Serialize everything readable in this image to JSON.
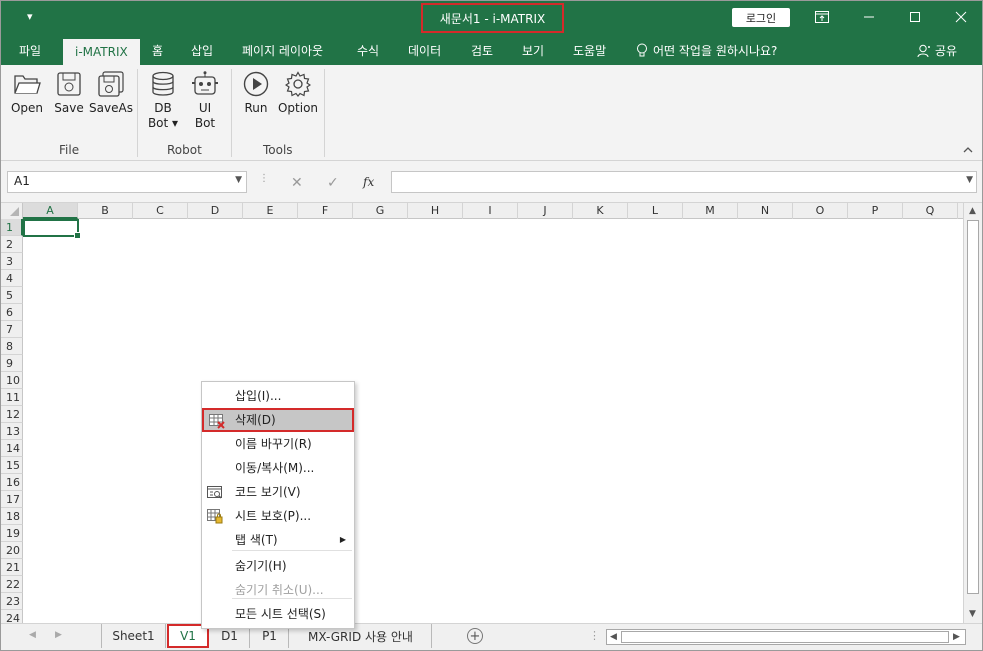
{
  "titlebar": {
    "qat_icon": "customize-arrow",
    "title": "새문서1  -  i-MATRIX",
    "login_label": "로그인",
    "controls": [
      "ribbon-display-icon",
      "minimize-icon",
      "maximize-icon",
      "close-icon"
    ]
  },
  "tabs": [
    {
      "label": "파일"
    },
    {
      "label": "i-MATRIX",
      "active": true
    },
    {
      "label": "홈"
    },
    {
      "label": "삽입"
    },
    {
      "label": "페이지 레이아웃"
    },
    {
      "label": "수식"
    },
    {
      "label": "데이터"
    },
    {
      "label": "검토"
    },
    {
      "label": "보기"
    },
    {
      "label": "도움말"
    },
    {
      "label": "어떤 작업을 원하시나요?"
    }
  ],
  "share_label": "공유",
  "ribbon": {
    "groups": [
      {
        "label": "File",
        "buttons": [
          {
            "label": "Open",
            "icon": "folder-icon"
          },
          {
            "label": "Save",
            "icon": "save-icon"
          },
          {
            "label": "SaveAs",
            "icon": "saveas-icon"
          }
        ]
      },
      {
        "label": "Robot",
        "buttons": [
          {
            "label": "DB\nBot",
            "line1": "DB",
            "line2": "Bot ▾",
            "icon": "database-icon"
          },
          {
            "label": "UI Bot",
            "line1": "UI",
            "line2": "Bot",
            "icon": "robot-icon"
          }
        ]
      },
      {
        "label": "Tools",
        "buttons": [
          {
            "label": "Run",
            "icon": "play-icon"
          },
          {
            "label": "Option",
            "icon": "gear-icon"
          }
        ]
      }
    ]
  },
  "formula_bar": {
    "name_box": "A1",
    "cancel_icon": "✕",
    "enter_icon": "✓",
    "fx": "fx",
    "formula": ""
  },
  "columns": [
    "A",
    "B",
    "C",
    "D",
    "E",
    "F",
    "G",
    "H",
    "I",
    "J",
    "K",
    "L",
    "M",
    "N",
    "O",
    "P",
    "Q"
  ],
  "rows": [
    "1",
    "2",
    "3",
    "4",
    "5",
    "6",
    "7",
    "8",
    "9",
    "10",
    "11",
    "12",
    "13",
    "14",
    "15",
    "16",
    "17",
    "18",
    "19",
    "20",
    "21",
    "22",
    "23",
    "24"
  ],
  "selected_cell": "A1",
  "context_menu": [
    {
      "label": "삽입(I)...",
      "icon": ""
    },
    {
      "label": "삭제(D)",
      "icon": "delete-sheet-icon",
      "highlight": true
    },
    {
      "label": "이름 바꾸기(R)",
      "icon": ""
    },
    {
      "label": "이동/복사(M)...",
      "icon": ""
    },
    {
      "label": "코드 보기(V)",
      "icon": "view-code-icon"
    },
    {
      "label": "시트 보호(P)...",
      "icon": "protect-sheet-icon"
    },
    {
      "label": "탭 색(T)",
      "icon": "",
      "submenu": true
    },
    {
      "label": "숨기기(H)",
      "icon": ""
    },
    {
      "label": "숨기기 취소(U)...",
      "icon": "",
      "disabled": true
    },
    {
      "label": "모든 시트 선택(S)",
      "icon": ""
    }
  ],
  "sheet_tabs": [
    {
      "label": "Sheet1"
    },
    {
      "label": "V1",
      "active": true
    },
    {
      "label": "D1"
    },
    {
      "label": "P1"
    },
    {
      "label": "MX-GRID 사용 안내"
    }
  ],
  "colors": {
    "accent": "#217346",
    "highlight_border": "#d42a2a"
  }
}
